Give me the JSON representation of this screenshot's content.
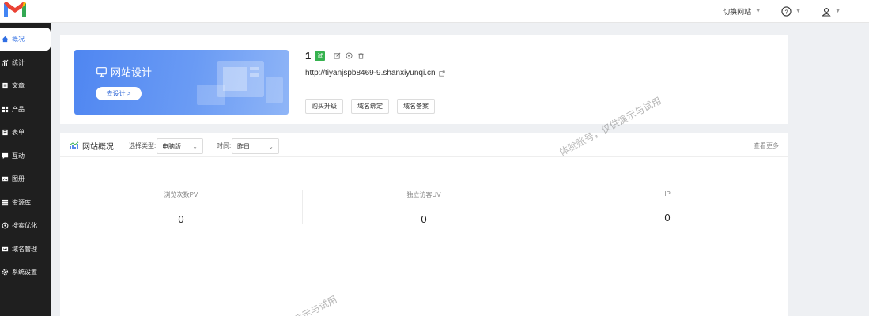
{
  "topbar": {
    "switch_site": "切换网站",
    "help_icon": "help-circle-icon",
    "user_icon": "user-icon"
  },
  "sidebar": {
    "items": [
      {
        "label": "概况",
        "icon": "home-icon",
        "active": true
      },
      {
        "label": "统计",
        "icon": "chart-icon"
      },
      {
        "label": "文章",
        "icon": "article-icon"
      },
      {
        "label": "产品",
        "icon": "grid-icon"
      },
      {
        "label": "表单",
        "icon": "form-icon"
      },
      {
        "label": "互动",
        "icon": "chat-icon"
      },
      {
        "label": "图册",
        "icon": "album-icon"
      },
      {
        "label": "资源库",
        "icon": "database-icon"
      },
      {
        "label": "搜索优化",
        "icon": "seo-icon"
      },
      {
        "label": "域名管理",
        "icon": "domain-icon"
      },
      {
        "label": "系统设置",
        "icon": "gear-icon"
      }
    ]
  },
  "site": {
    "banner_title": "网站设计",
    "banner_button": "去设计 >",
    "number": "1",
    "badge": "试",
    "url": "http://tiyanjspb8469-9.shanxiyunqi.cn",
    "buttons": [
      "购买升级",
      "域名绑定",
      "域名备案"
    ]
  },
  "overview": {
    "title": "网站概况",
    "type_label": "选择类型:",
    "type_value": "电脑版",
    "time_label": "时间:",
    "time_value": "昨日",
    "more": "查看更多",
    "stats": [
      {
        "label": "浏览次数PV",
        "value": "0"
      },
      {
        "label": "独立访客UV",
        "value": "0"
      },
      {
        "label": "IP",
        "value": "0"
      }
    ]
  },
  "watermark": {
    "text1": "体验账号，仅供演示与试用",
    "text2": "演示与试用"
  },
  "colors": {
    "accent": "#2f6ee3",
    "sidebar_bg": "#1f1f1f",
    "badge_green": "#36b24f"
  }
}
